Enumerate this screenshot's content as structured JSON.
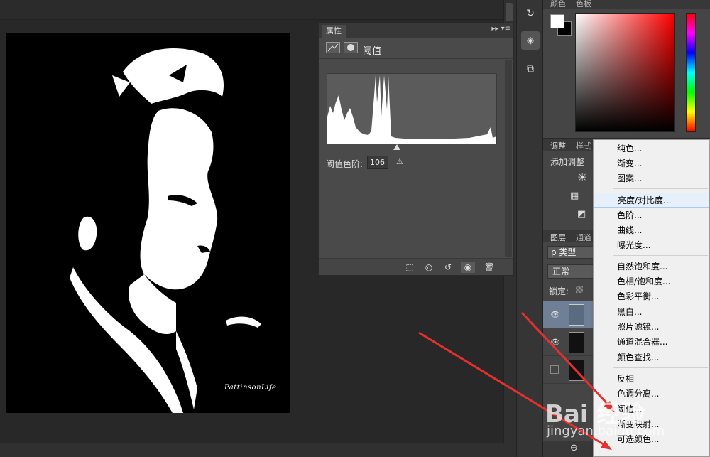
{
  "properties_panel": {
    "tab": "属性",
    "title": "阈值",
    "threshold_label": "阈值色阶:",
    "threshold_value": "106"
  },
  "photo": {
    "signature": "PattinsonLife"
  },
  "color_panel": {
    "tabs": [
      "颜色",
      "色板"
    ],
    "foreground": "#ffffff",
    "background": "#000000"
  },
  "adjustments_panel": {
    "tabs": [
      "调整",
      "样式"
    ],
    "add_label": "添加调整"
  },
  "layers_panel": {
    "tabs": [
      "图层",
      "通道"
    ],
    "filter": "ρ 类型",
    "blend_mode": "正常",
    "lock_label": "锁定:"
  },
  "context_menu": {
    "items": [
      {
        "label": "纯色...",
        "group": 1
      },
      {
        "label": "渐变...",
        "group": 1
      },
      {
        "label": "图案...",
        "group": 1
      },
      {
        "label": "亮度/对比度...",
        "group": 2,
        "highlighted": true
      },
      {
        "label": "色阶...",
        "group": 2
      },
      {
        "label": "曲线...",
        "group": 2
      },
      {
        "label": "曝光度...",
        "group": 2
      },
      {
        "label": "自然饱和度...",
        "group": 3
      },
      {
        "label": "色相/饱和度...",
        "group": 3
      },
      {
        "label": "色彩平衡...",
        "group": 3
      },
      {
        "label": "黑白...",
        "group": 3
      },
      {
        "label": "照片滤镜...",
        "group": 3
      },
      {
        "label": "通道混合器...",
        "group": 3
      },
      {
        "label": "颜色查找...",
        "group": 3
      },
      {
        "label": "反相",
        "group": 4
      },
      {
        "label": "色调分离...",
        "group": 4
      },
      {
        "label": "阈值...",
        "group": 4
      },
      {
        "label": "渐变映射...",
        "group": 4
      },
      {
        "label": "可选颜色...",
        "group": 4
      }
    ]
  },
  "watermark": {
    "brand": "Bai 经验",
    "url": "jingyan.baidu.com"
  },
  "icons": [
    "history-icon",
    "3d-icon",
    "tool-presets-icon",
    "eye-icon",
    "link-icon",
    "trash-icon",
    "reset-icon",
    "clip-icon",
    "warning-icon",
    "sun-icon"
  ],
  "accent_colors": {
    "arrow": "#e53030",
    "menu_highlight": "#e5f0fb"
  }
}
